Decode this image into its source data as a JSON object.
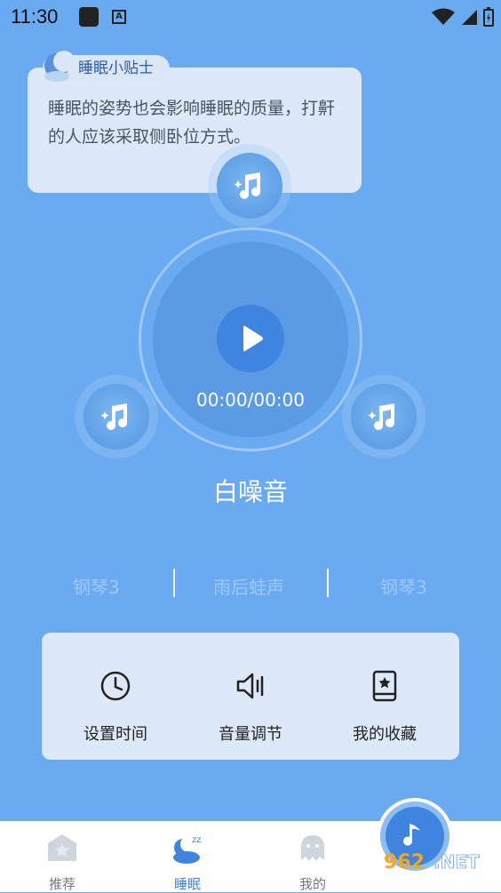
{
  "status_bar": {
    "time": "11:30",
    "notif_icon": "a-icon"
  },
  "tip": {
    "label": "睡眠小贴士",
    "text": "睡眠的姿势也会影响睡眠的质量，打鼾的人应该采取侧卧位方式。"
  },
  "player": {
    "timer": "00:00/00:00",
    "title": "白噪音",
    "state": "paused"
  },
  "tracks": [
    {
      "label": "钢琴3"
    },
    {
      "label": "雨后蛙声"
    },
    {
      "label": "钢琴3"
    }
  ],
  "controls": [
    {
      "label": "设置时间",
      "icon": "clock-icon"
    },
    {
      "label": "音量调节",
      "icon": "volume-icon"
    },
    {
      "label": "我的收藏",
      "icon": "favorites-icon"
    }
  ],
  "nav": [
    {
      "label": "推荐",
      "icon": "recommend-icon",
      "active": false
    },
    {
      "label": "睡眠",
      "icon": "sleep-icon",
      "active": true
    },
    {
      "label": "我的",
      "icon": "profile-icon",
      "active": false
    }
  ],
  "colors": {
    "background": "#6aaaf0",
    "accent": "#3f84df",
    "panel": "#dde9f8"
  }
}
